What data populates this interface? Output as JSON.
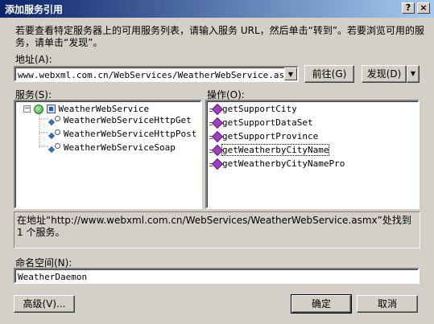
{
  "window": {
    "title": "添加服务引用",
    "help_btn": "?",
    "close_btn": "×"
  },
  "description": "若要查看特定服务器上的可用服务列表，请输入服务 URL，然后单击“转到”。若要浏览可用的服务，请单击“发现”。",
  "address": {
    "label": "地址(A):",
    "value": "www.webxml.com.cn/WebServices/WeatherWebService.asmx",
    "go_button": "前往(G)",
    "discover_button": "发现(D)"
  },
  "services": {
    "label": "服务(S):",
    "root": "WeatherWebService",
    "children": [
      "WeatherWebServiceHttpGet",
      "WeatherWebServiceHttpPost",
      "WeatherWebServiceSoap"
    ]
  },
  "operations": {
    "label": "操作(O):",
    "items": [
      "getSupportCity",
      "getSupportDataSet",
      "getSupportProvince",
      "getWeatherbyCityName",
      "getWeatherbyCityNamePro"
    ]
  },
  "status": "在地址“http://www.webxml.com.cn/WebServices/WeatherWebService.asmx”处找到 1 个服务。",
  "namespace": {
    "label": "命名空间(N):",
    "value": "WeatherDaemon"
  },
  "buttons": {
    "advanced": "高级(V)...",
    "ok": "确定",
    "cancel": "取消"
  }
}
